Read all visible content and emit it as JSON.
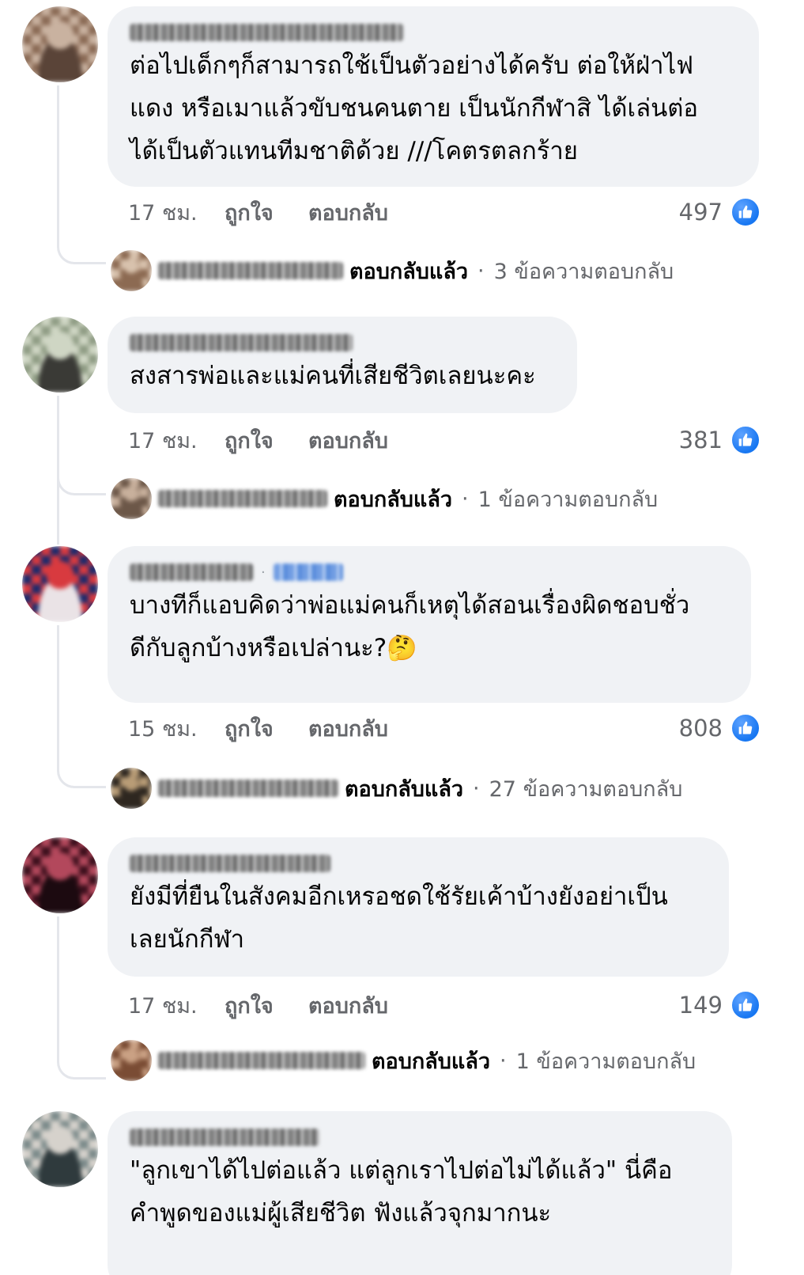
{
  "comments": [
    {
      "body": "ต่อไปเด็กๆก็สามารถใช้เป็นตัวอย่างได้ครับ ต่อให้ฝ่าไฟ\nแดง หรือเมาแล้วขับชนคนตาย เป็นนักกีฬาสิ ได้เล่นต่อ\nได้เป็นตัวแทนทีมชาติด้วย ///โคตรตลกร้าย",
      "time": "17 ชม.",
      "like_label": "ถูกใจ",
      "reply_label": "ตอบกลับ",
      "reaction_count": "497",
      "replied_label": "ตอบกลับแล้ว",
      "reply_count_text": "3 ข้อความตอบกลับ",
      "avatar_colors": [
        "#8a6a55",
        "#c9b2a0",
        "#5a4438"
      ]
    },
    {
      "body": "สงสารพ่อและแม่คนที่เสียชีวิตเลยนะคะ",
      "time": "17 ชม.",
      "like_label": "ถูกใจ",
      "reply_label": "ตอบกลับ",
      "reaction_count": "381",
      "replied_label": "ตอบกลับแล้ว",
      "reply_count_text": "1 ข้อความตอบกลับ",
      "avatar_colors": [
        "#8f9c84",
        "#cfd6c4",
        "#3a3a36"
      ]
    },
    {
      "body": "บางทีก็แอบคิดว่าพ่อแม่คนก็เหตุได้สอนเรื่องผิดชอบชั่ว\nดีกับลูกบ้างหรือเปล่านะ?🤔",
      "time": "15 ชม.",
      "like_label": "ถูกใจ",
      "reply_label": "ตอบกลับ",
      "reaction_count": "808",
      "replied_label": "ตอบกลับแล้ว",
      "reply_count_text": "27 ข้อความตอบกลับ",
      "avatar_colors": [
        "#1d2a6b",
        "#d83a3f",
        "#eae3e6"
      ]
    },
    {
      "body": "ยังมีที่ยืนในสังคมอีกเหรอชดใช้รัยเค้าบ้างยังอย่าเป็น\nเลยนักกีฬา",
      "time": "17 ชม.",
      "like_label": "ถูกใจ",
      "reply_label": "ตอบกลับ",
      "reaction_count": "149",
      "replied_label": "ตอบกลับแล้ว",
      "reply_count_text": "1 ข้อความตอบกลับ",
      "avatar_colors": [
        "#3b0f1c",
        "#b3485c",
        "#1c0a10"
      ]
    },
    {
      "body": "\"ลูกเขาได้ไปต่อแล้ว แต่ลูกเราไปต่อไม่ได้แล้ว\"  นี่คือ\nคำพูดของแม่ผู้เสียชีวิต  ฟังแล้วจุกมากนะ",
      "avatar_colors": [
        "#7b8a8a",
        "#d6d2cc",
        "#2f3a3d"
      ]
    }
  ],
  "reply_avatar_colors": [
    [
      "#8c6a52",
      "#d8c2ad"
    ],
    [
      "#6c5748",
      "#c8b09c"
    ],
    [
      "#2e2720",
      "#b89c76"
    ],
    [
      "#7a4c34",
      "#caa184"
    ]
  ],
  "colors": {
    "bubble": "#f0f2f5",
    "meta_text": "#65676b",
    "like_blue": "#1877f2"
  },
  "icons": {
    "like": "thumbs-up-icon"
  }
}
